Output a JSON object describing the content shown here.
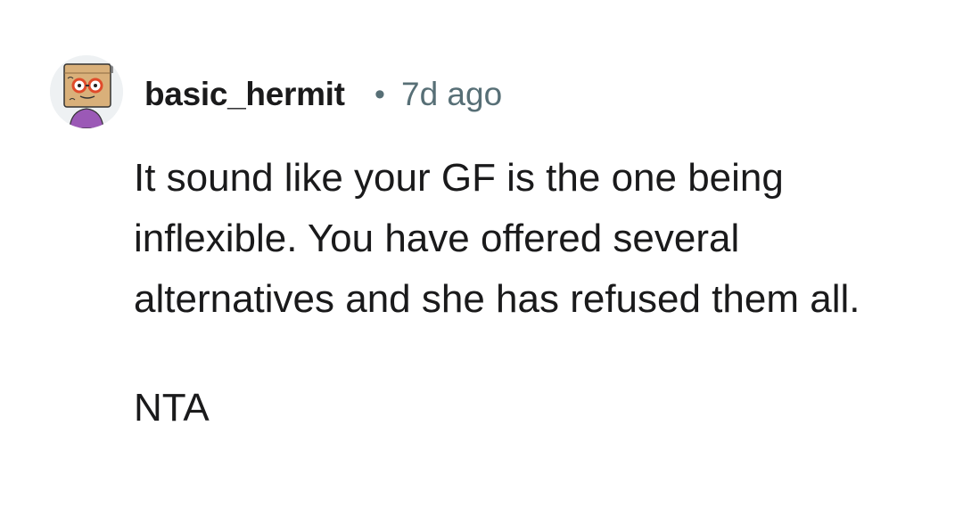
{
  "comment": {
    "author": "basic_hermit",
    "separator": "•",
    "age": "7d ago",
    "avatar_icon": "snoo-avatar-icon",
    "paragraphs": [
      "It sound like your GF is the one being inflexible. You have offered several alternatives and she has refused them all.",
      "NTA"
    ]
  },
  "colors": {
    "text": "#1a1a1b",
    "meta": "#576f76",
    "avatar_bg": "#eef1f3"
  }
}
